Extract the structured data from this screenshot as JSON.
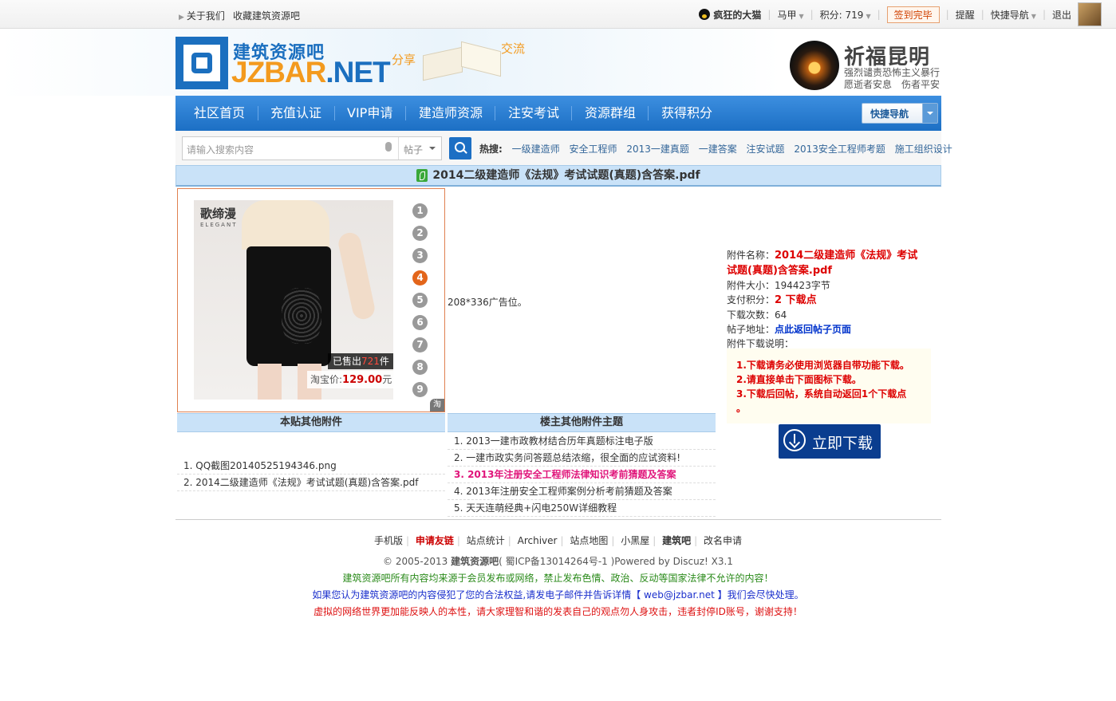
{
  "topbar": {
    "about": "关于我们",
    "bookmark": "收藏建筑资源吧",
    "username": "疯狂的大猫",
    "user_menu": "马甲",
    "points": "积分: 719",
    "sign": "签到完毕",
    "remind": "提醒",
    "quicknav": "快捷导航",
    "logout": "退出"
  },
  "logo": {
    "cn": "建筑资源吧",
    "en_a": "JZBAR",
    "en_b": ".NET",
    "share": "分享",
    "exchange": "交流"
  },
  "memorial": {
    "title": "祈福昆明",
    "line1": "强烈谴责恐怖主义暴行",
    "line2": "愿逝者安息　伤者平安"
  },
  "nav": {
    "items": [
      "社区首页",
      "充值认证",
      "VIP申请",
      "建造师资源",
      "注安考试",
      "资源群组",
      "获得积分"
    ],
    "quicknav": "快捷导航"
  },
  "search": {
    "placeholder": "请输入搜索内容",
    "scope": "帖子",
    "hot_label": "热搜:",
    "hot": [
      "一级建造师",
      "安全工程师",
      "2013一建真题",
      "一建答案",
      "注安试题",
      "2013安全工程师考题",
      "施工组织设计"
    ]
  },
  "title": "2014二级建造师《法规》考试试题(真题)含答案.pdf",
  "ad": {
    "brand": "歌缔漫",
    "brand_en": "ELEGANT",
    "sold_prefix": "已售出",
    "sold_count": "721",
    "sold_suffix": "件",
    "price_label": "淘宝价:",
    "price": "129.00",
    "price_unit": "元",
    "pages": [
      "1",
      "2",
      "3",
      "4",
      "5",
      "6",
      "7",
      "8",
      "9"
    ],
    "active_page": "4",
    "tao": "淘",
    "slot_text": "208*336广告位。"
  },
  "info": {
    "name_label": "附件名称：",
    "name_value": "2014二级建造师《法规》考试试题(真题)含答案.pdf",
    "size_label": "附件大小：",
    "size_value": "194423字节",
    "cost_label": "支付积分：",
    "cost_value": "2 下载点",
    "count_label": "下载次数：",
    "count_value": "64",
    "post_label": "帖子地址：",
    "post_value": "点此返回帖子页面",
    "desc_label": "附件下载说明："
  },
  "notice": [
    "1.下载请务必使用浏览器自带功能下载。",
    "2.请直接单击下面图标下载。",
    "3.下载后回帖，系统自动返回1个下载点",
    "。"
  ],
  "download_label": "立即下载",
  "lists": {
    "left_head": "本贴其他附件",
    "left_items": [
      "1. QQ截图20140525194346.png",
      "2. 2014二级建造师《法规》考试试题(真题)含答案.pdf"
    ],
    "right_head": "楼主其他附件主题",
    "right_items": [
      "1. 2013一建市政教材结合历年真题标注电子版",
      "2. 一建市政实务问答题总结浓缩，很全面的应试资料!",
      "3. 2013年注册安全工程师法律知识考前猜题及答案",
      "4. 2013年注册安全工程师案例分析考前猜题及答案",
      "5. 天天连萌经典+闪电250W详细教程"
    ],
    "right_highlight_index": 2
  },
  "footer": {
    "links": [
      "手机版",
      "申请友链",
      "站点统计",
      "Archiver",
      "站点地图",
      "小黑屋",
      "建筑吧",
      "改名申请"
    ],
    "copyright_a": "© 2005-2013 ",
    "copyright_site": "建筑资源吧",
    "copyright_b": "( 蜀ICP备13014264号-1 )Powered by Discuz! X3.1",
    "line_green": "建筑资源吧所有内容均来源于会员发布或网络，禁止发布色情、政治、反动等国家法律不允许的内容！",
    "line_blue": "如果您认为建筑资源吧的内容侵犯了您的合法权益,请发电子邮件并告诉详情【 web@jzbar.net 】我们会尽快处理。",
    "line_red": "虚拟的网络世界更加能反映人的本性，请大家理智和谐的发表自己的观点勿人身攻击，违者封停ID账号，谢谢支持！",
    "colors": {
      "green": "#2a8a1a",
      "blue": "#1a2fcc",
      "red": "#dd1111"
    }
  },
  "colors": {
    "nav": "#1c6fc4",
    "accent": "#f39a1e",
    "title_bg": "#c9e2f8"
  }
}
